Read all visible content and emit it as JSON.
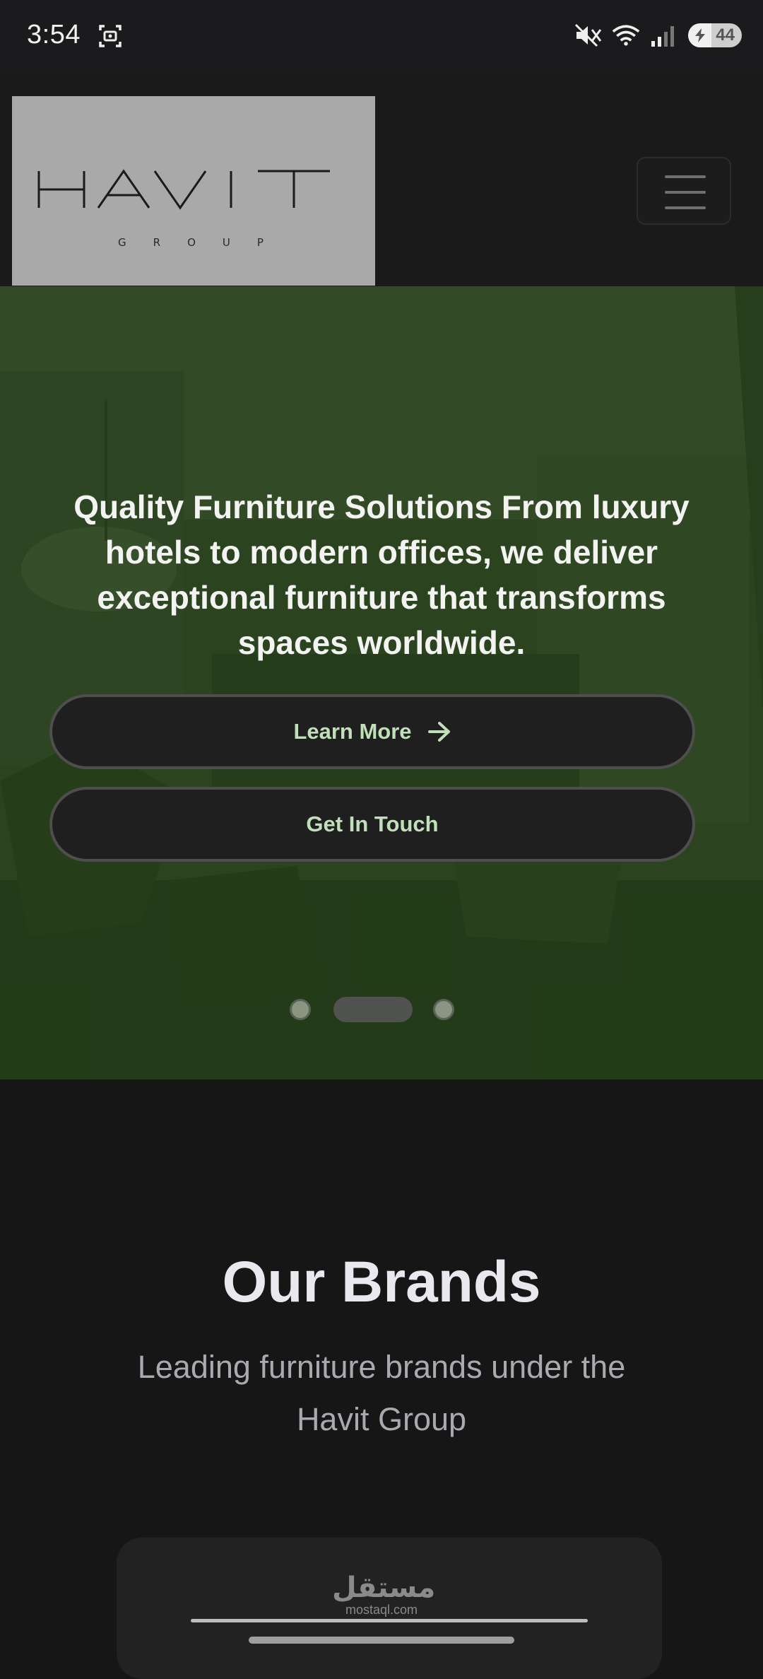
{
  "status_bar": {
    "time": "3:54",
    "battery_level": "44",
    "icons": [
      "screen-record-icon",
      "mute-icon",
      "wifi-icon",
      "signal-icon",
      "battery-icon"
    ]
  },
  "navbar": {
    "logo_text": "HAVIT",
    "logo_subtext": "GROUP",
    "menu_icon": "hamburger-menu-icon"
  },
  "hero": {
    "title": "Quality Furniture Solutions From luxury hotels to modern offices, we deliver exceptional furniture that transforms spaces worldwide.",
    "primary_button": "Learn More",
    "secondary_button": "Get In Touch",
    "carousel": {
      "slides": 3,
      "active_index": 1
    },
    "overlay_color": "#224612"
  },
  "brands": {
    "title": "Our Brands",
    "subtitle": "Leading furniture brands under the Havit Group"
  },
  "watermark": {
    "arabic": "مستقل",
    "latin": "mostaql.com"
  }
}
